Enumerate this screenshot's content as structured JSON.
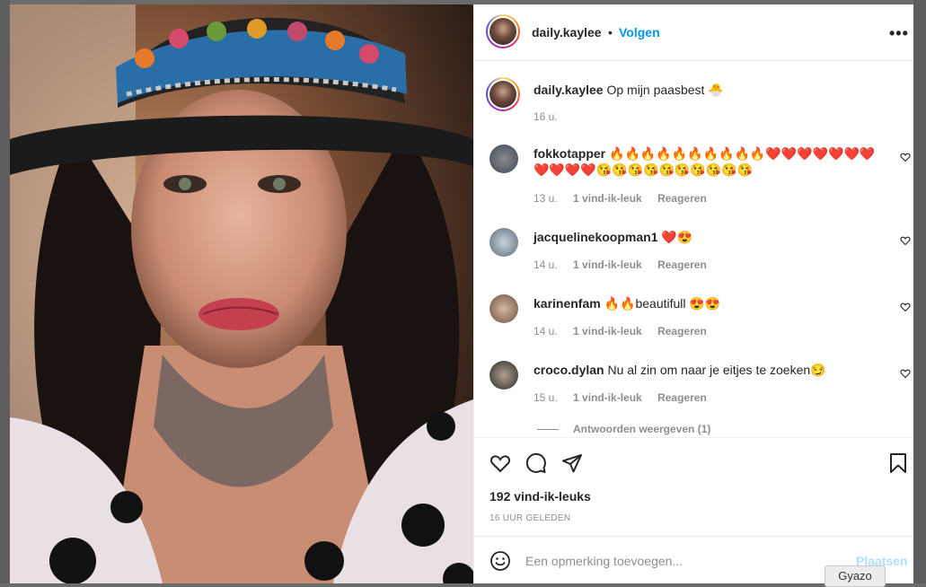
{
  "post": {
    "author": "daily.kaylee",
    "follow_label": "Volgen",
    "separator": "•",
    "more_label": "•••",
    "caption_text": "Op mijn paasbest 🐣",
    "caption_time": "16 u."
  },
  "comments": [
    {
      "username": "fokkotapper",
      "text": "🔥🔥🔥🔥🔥🔥🔥🔥🔥🔥❤️❤️❤️❤️❤️❤️❤️❤️❤️❤️❤️😘😘😘😘😘😘😘😘😘😘",
      "time": "13 u.",
      "likes": "1 vind-ik-leuk",
      "reply": "Reageren"
    },
    {
      "username": "jacquelinekoopman1",
      "text": "❤️😍",
      "time": "14 u.",
      "likes": "1 vind-ik-leuk",
      "reply": "Reageren"
    },
    {
      "username": "karinenfam",
      "text": "🔥🔥beautifull 😍😍",
      "time": "14 u.",
      "likes": "1 vind-ik-leuk",
      "reply": "Reageren"
    },
    {
      "username": "croco.dylan",
      "text": "Nu al zin om naar je eitjes te zoeken😏",
      "time": "15 u.",
      "likes": "1 vind-ik-leuk",
      "reply": "Reageren"
    }
  ],
  "view_replies": "Antwoorden weergeven (1)",
  "likes_count": "192 vind-ik-leuks",
  "posted_time": "16 UUR GELEDEN",
  "add_comment": {
    "placeholder": "Een opmerking toevoegen...",
    "post_label": "Plaatsen"
  },
  "tooltip": "Gyazo",
  "icons": [
    "more-options-icon",
    "heart-icon",
    "comment-icon",
    "share-icon",
    "bookmark-icon",
    "emoji-icon"
  ],
  "colors": {
    "link": "#0095f6",
    "text": "#262626",
    "muted": "#8e8e8e",
    "post_disabled": "#b2dffc"
  }
}
